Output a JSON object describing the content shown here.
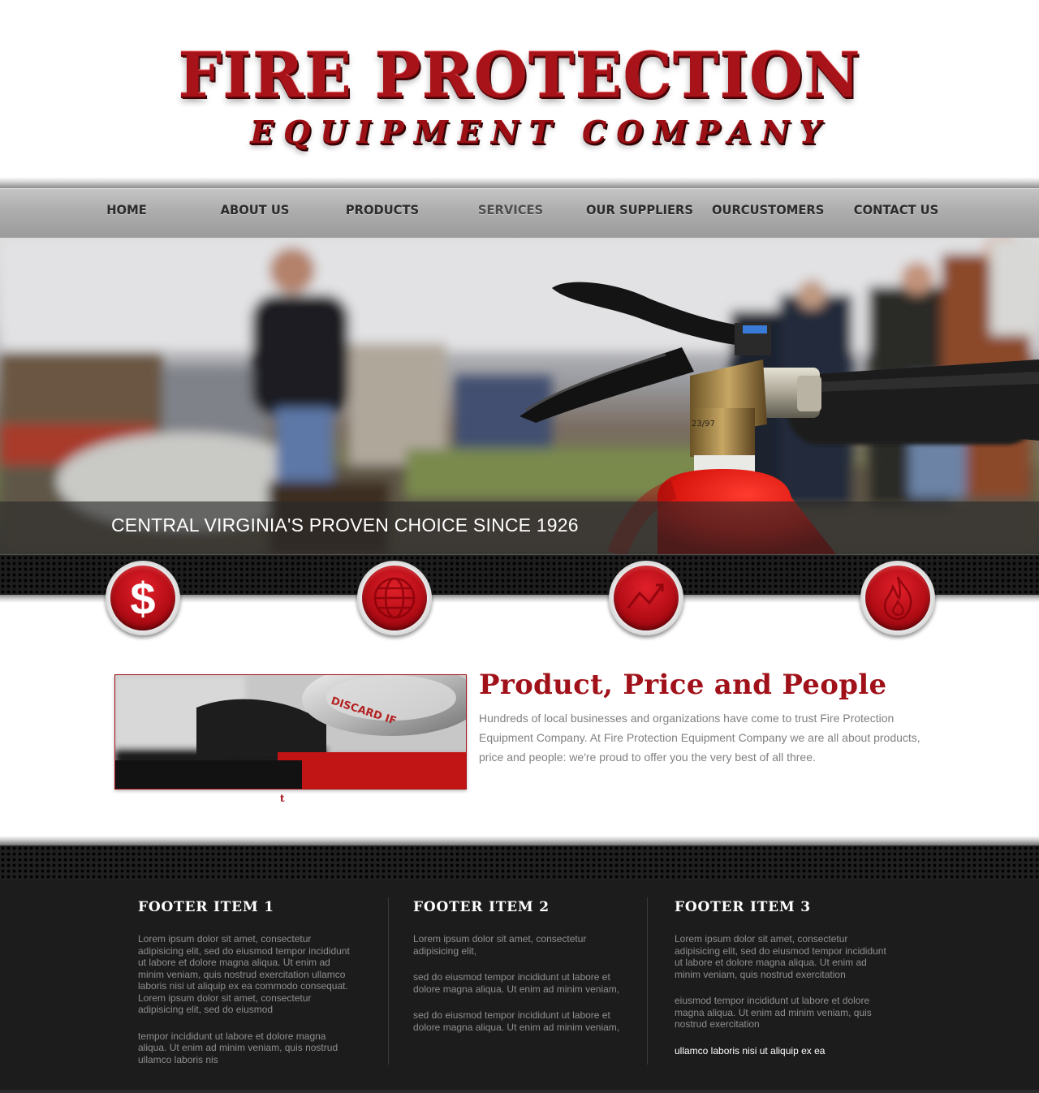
{
  "logo": {
    "main": "FIRE PROTECTION",
    "sub": "EQUIPMENT COMPANY"
  },
  "nav": {
    "items": [
      {
        "label": "HOME"
      },
      {
        "label": "ABOUT US"
      },
      {
        "label": "PRODUCTS"
      },
      {
        "label": "SERVICES"
      },
      {
        "label": "OUR SUPPLIERS"
      },
      {
        "label": "OURCUSTOMERS"
      },
      {
        "label": "CONTACT US"
      }
    ],
    "active": "SERVICES"
  },
  "hero": {
    "caption": "CENTRAL VIRGINIA'S PROVEN CHOICE SINCE 1926",
    "extinguisher_label": "23/97"
  },
  "features": [
    {
      "icon": "dollar-icon"
    },
    {
      "icon": "globe-icon"
    },
    {
      "icon": "chart-icon"
    },
    {
      "icon": "flame-icon"
    }
  ],
  "content": {
    "title": "Product, Price and People",
    "body": "Hundreds of local businesses and organizations have come to trust Fire Protection Equipment Company. At Fire Protection Equipment Company we are all about products, price and people: we're proud to offer you the very best of all three.",
    "image_caption": "t",
    "image_label": "DISCARD IF"
  },
  "footer": {
    "columns": [
      {
        "title": "FOOTER ITEM 1",
        "paragraphs": [
          "Lorem ipsum dolor sit amet, consectetur adipisicing elit, sed do eiusmod tempor incididunt ut labore et dolore magna aliqua. Ut enim ad minim veniam, quis nostrud exercitation ullamco laboris nisi ut aliquip ex ea commodo consequat. Lorem ipsum dolor sit amet, consectetur adipisicing elit, sed do eiusmod",
          "tempor incididunt ut labore et dolore magna aliqua. Ut enim ad minim veniam, quis nostrud  ullamco laboris nis"
        ]
      },
      {
        "title": "FOOTER ITEM 2",
        "paragraphs": [
          "Lorem ipsum dolor sit amet, consectetur adipisicing elit,",
          "sed do eiusmod tempor incididunt ut labore et dolore magna aliqua. Ut enim ad minim veniam,",
          "sed do eiusmod tempor incididunt ut labore et dolore magna aliqua. Ut enim ad minim veniam,"
        ]
      },
      {
        "title": "FOOTER ITEM 3",
        "paragraphs": [
          "Lorem ipsum dolor sit amet, consectetur adipisicing elit, sed do eiusmod tempor incididunt ut labore et dolore magna aliqua. Ut enim ad minim veniam, quis nostrud exercitation",
          "eiusmod tempor incididunt ut labore et dolore magna aliqua. Ut enim ad minim veniam, quis nostrud exercitation",
          "ullamco laboris nisi ut aliquip ex ea"
        ]
      }
    ]
  },
  "colors": {
    "brand_red": "#a1111a",
    "nav_gray": "#adadad",
    "footer_bg": "#1c1c1c",
    "body_text": "#808080"
  }
}
